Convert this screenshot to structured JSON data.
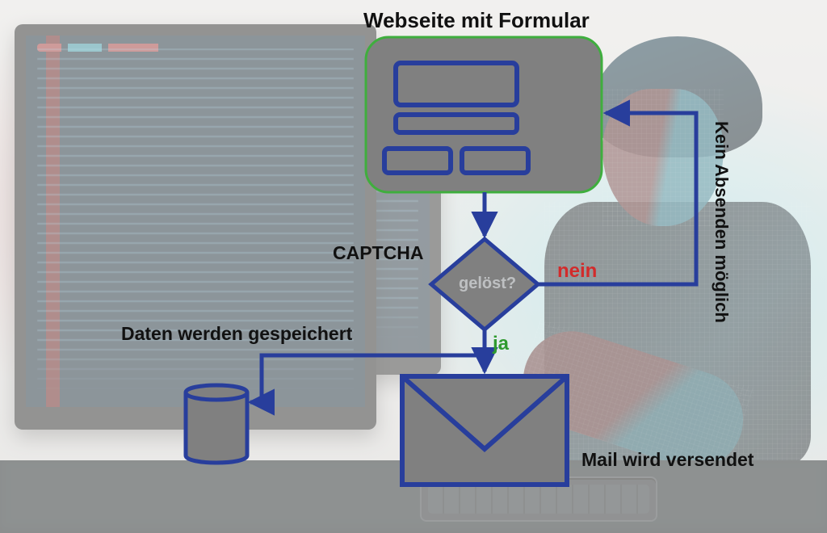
{
  "diagram": {
    "title": "Webseite mit Formular",
    "decision": {
      "label_left": "CAPTCHA",
      "question": "gelöst?",
      "yes": "ja",
      "no": "nein"
    },
    "paths": {
      "no_result": "Kein Absenden möglich",
      "stored": "Daten werden gespeichert",
      "mail_sent": "Mail wird versendet"
    }
  },
  "colors": {
    "stroke": "#283e9c",
    "fill": "#808080",
    "form_outline": "#3fae3e",
    "yes": "#2f9a2f",
    "no": "#d22b2b"
  }
}
